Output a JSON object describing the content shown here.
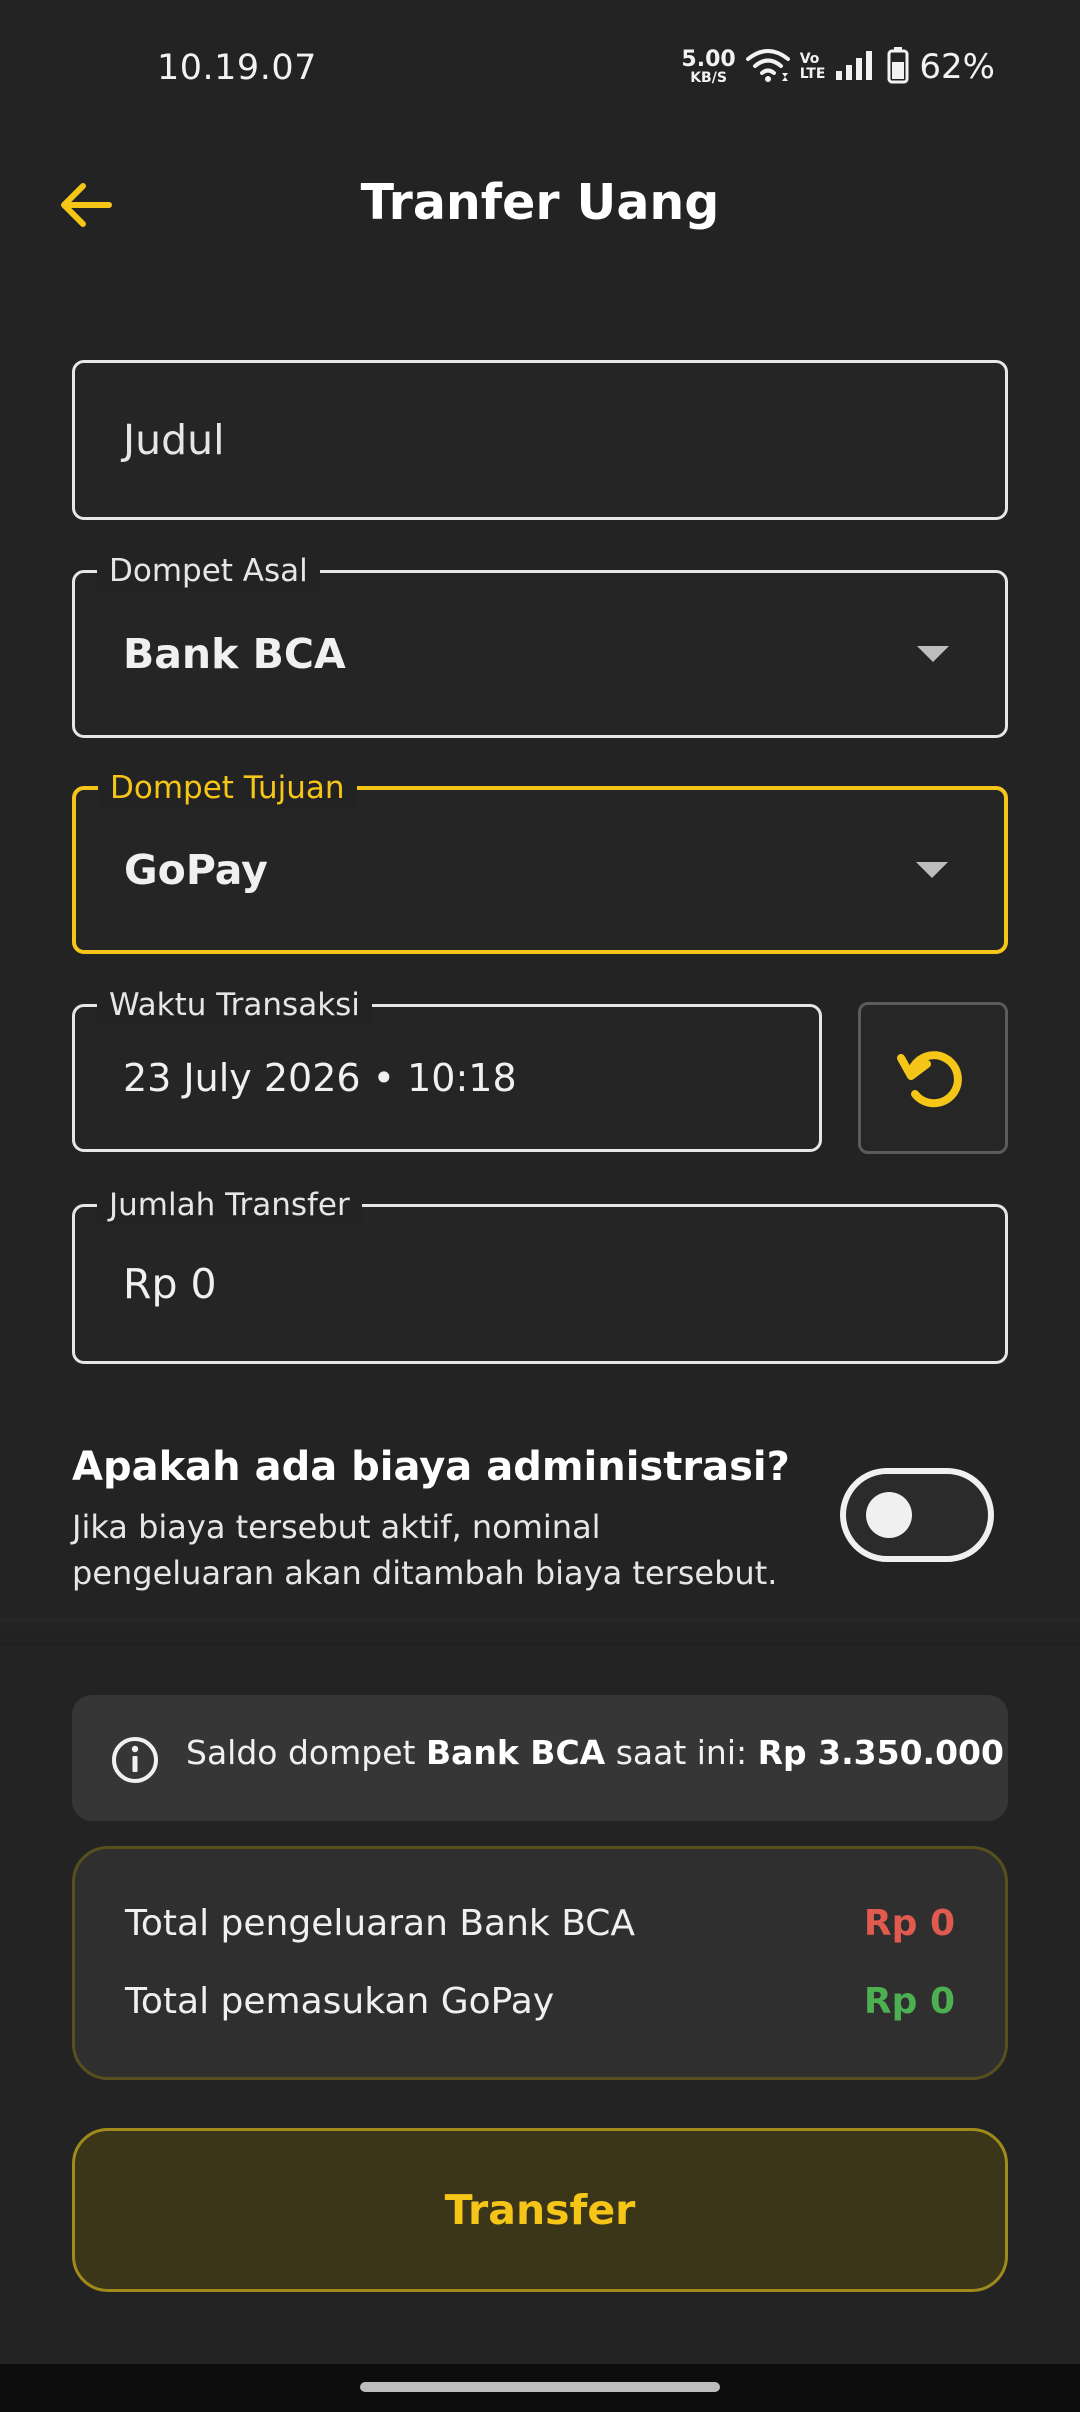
{
  "status_bar": {
    "time": "10.19.07",
    "net_speed_value": "5.00",
    "net_speed_unit": "KB/S",
    "volte_top": "Vo",
    "volte_bottom": "LTE",
    "battery": "62%"
  },
  "header": {
    "title": "Tranfer Uang"
  },
  "form": {
    "judul": {
      "placeholder": "Judul"
    },
    "dompet_asal": {
      "label": "Dompet Asal",
      "value": "Bank BCA"
    },
    "dompet_tujuan": {
      "label": "Dompet Tujuan",
      "value": "GoPay"
    },
    "waktu_transaksi": {
      "label": "Waktu Transaksi",
      "value": "23 July 2026 • 10:18"
    },
    "jumlah_transfer": {
      "label": "Jumlah Transfer",
      "value": "Rp 0"
    }
  },
  "admin_fee": {
    "title": "Apakah ada biaya administrasi?",
    "description": "Jika biaya tersebut aktif, nominal pengeluaran akan ditambah biaya tersebut.",
    "enabled": false
  },
  "info": {
    "prefix": "Saldo dompet ",
    "wallet": "Bank BCA",
    "middle": " saat ini: ",
    "balance": "Rp 3.350.000"
  },
  "totals": {
    "outgoing_label": "Total pengeluaran Bank BCA",
    "outgoing_value": "Rp 0",
    "incoming_label": "Total pemasukan GoPay",
    "incoming_value": "Rp 0"
  },
  "actions": {
    "transfer_label": "Transfer"
  },
  "colors": {
    "background": "#232323",
    "accent": "#f5c518",
    "negative": "#e05a4f",
    "positive": "#4caf50"
  }
}
